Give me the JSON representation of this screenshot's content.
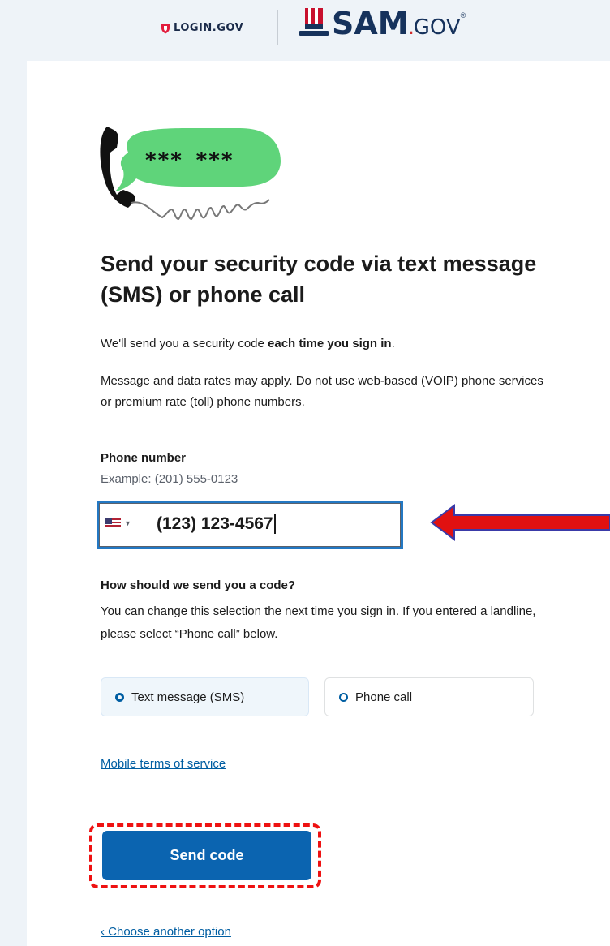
{
  "header": {
    "login_brand": "LOGIN.GOV",
    "sam_brand_main": "SAM",
    "sam_brand_dot": ".",
    "sam_brand_suffix": "GOV",
    "sam_brand_mark": "®"
  },
  "hero": {
    "icon": "phone-speech-bubble-icon",
    "bubble_text": "*** ***"
  },
  "main": {
    "title": "Send your security code via text message (SMS) or phone call",
    "intro_prefix": "We'll send you a security code ",
    "intro_bold": "each time you sign in",
    "intro_suffix": ".",
    "rates_notice": "Message and data rates may apply. Do not use web-based (VOIP) phone services or premium rate (toll) phone numbers."
  },
  "phone": {
    "label": "Phone number",
    "hint": "Example: (201) 555-0123",
    "country": "US",
    "value": "(123) 123-4567"
  },
  "delivery": {
    "question": "How should we send you a code?",
    "description": "You can change this selection the next time you sign in. If you entered a landline, please select “Phone call” below.",
    "options": [
      {
        "label": "Text message (SMS)",
        "selected": true
      },
      {
        "label": "Phone call",
        "selected": false
      }
    ]
  },
  "links": {
    "terms": "Mobile terms of service",
    "back": "‹ Choose another option"
  },
  "actions": {
    "send_label": "Send code"
  },
  "colors": {
    "primary": "#005ea2",
    "button": "#0b64b0",
    "bubble": "#5fd47a",
    "annotation_red": "#e11111",
    "annotation_blue": "#3a3aa8"
  }
}
